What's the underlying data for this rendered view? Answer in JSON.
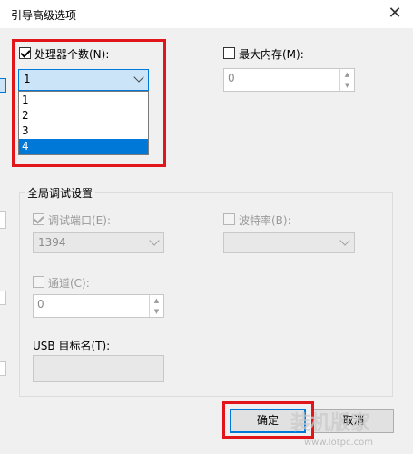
{
  "window": {
    "title": "引导高级选项",
    "close_glyph": "✕"
  },
  "processor": {
    "label": "处理器个数(N):",
    "checked": true,
    "selected": "1",
    "options": [
      "1",
      "2",
      "3",
      "4"
    ],
    "highlighted": "4"
  },
  "memory": {
    "label": "最大内存(M):",
    "checked": false,
    "value": "0"
  },
  "debug": {
    "group_label": "全局调试设置",
    "port": {
      "label": "调试端口(E):",
      "checked": true,
      "value": "1394"
    },
    "baud": {
      "label": "波特率(B):",
      "checked": false,
      "value": ""
    },
    "channel": {
      "label": "通道(C):",
      "checked": false,
      "value": "0"
    },
    "usb": {
      "label": "USB 目标名(T):",
      "value": ""
    }
  },
  "buttons": {
    "ok": "确定",
    "cancel": "取消"
  },
  "watermark": {
    "text": "装机版家",
    "url": "www.lotpc.com"
  },
  "colors": {
    "accent": "#0078d7",
    "highlight_box": "#e0161b",
    "selected_item": "#0078d7"
  },
  "icons": {
    "close": "close-icon",
    "dropdown": "chevron-down-icon",
    "spin": "spin-arrows-icon"
  }
}
